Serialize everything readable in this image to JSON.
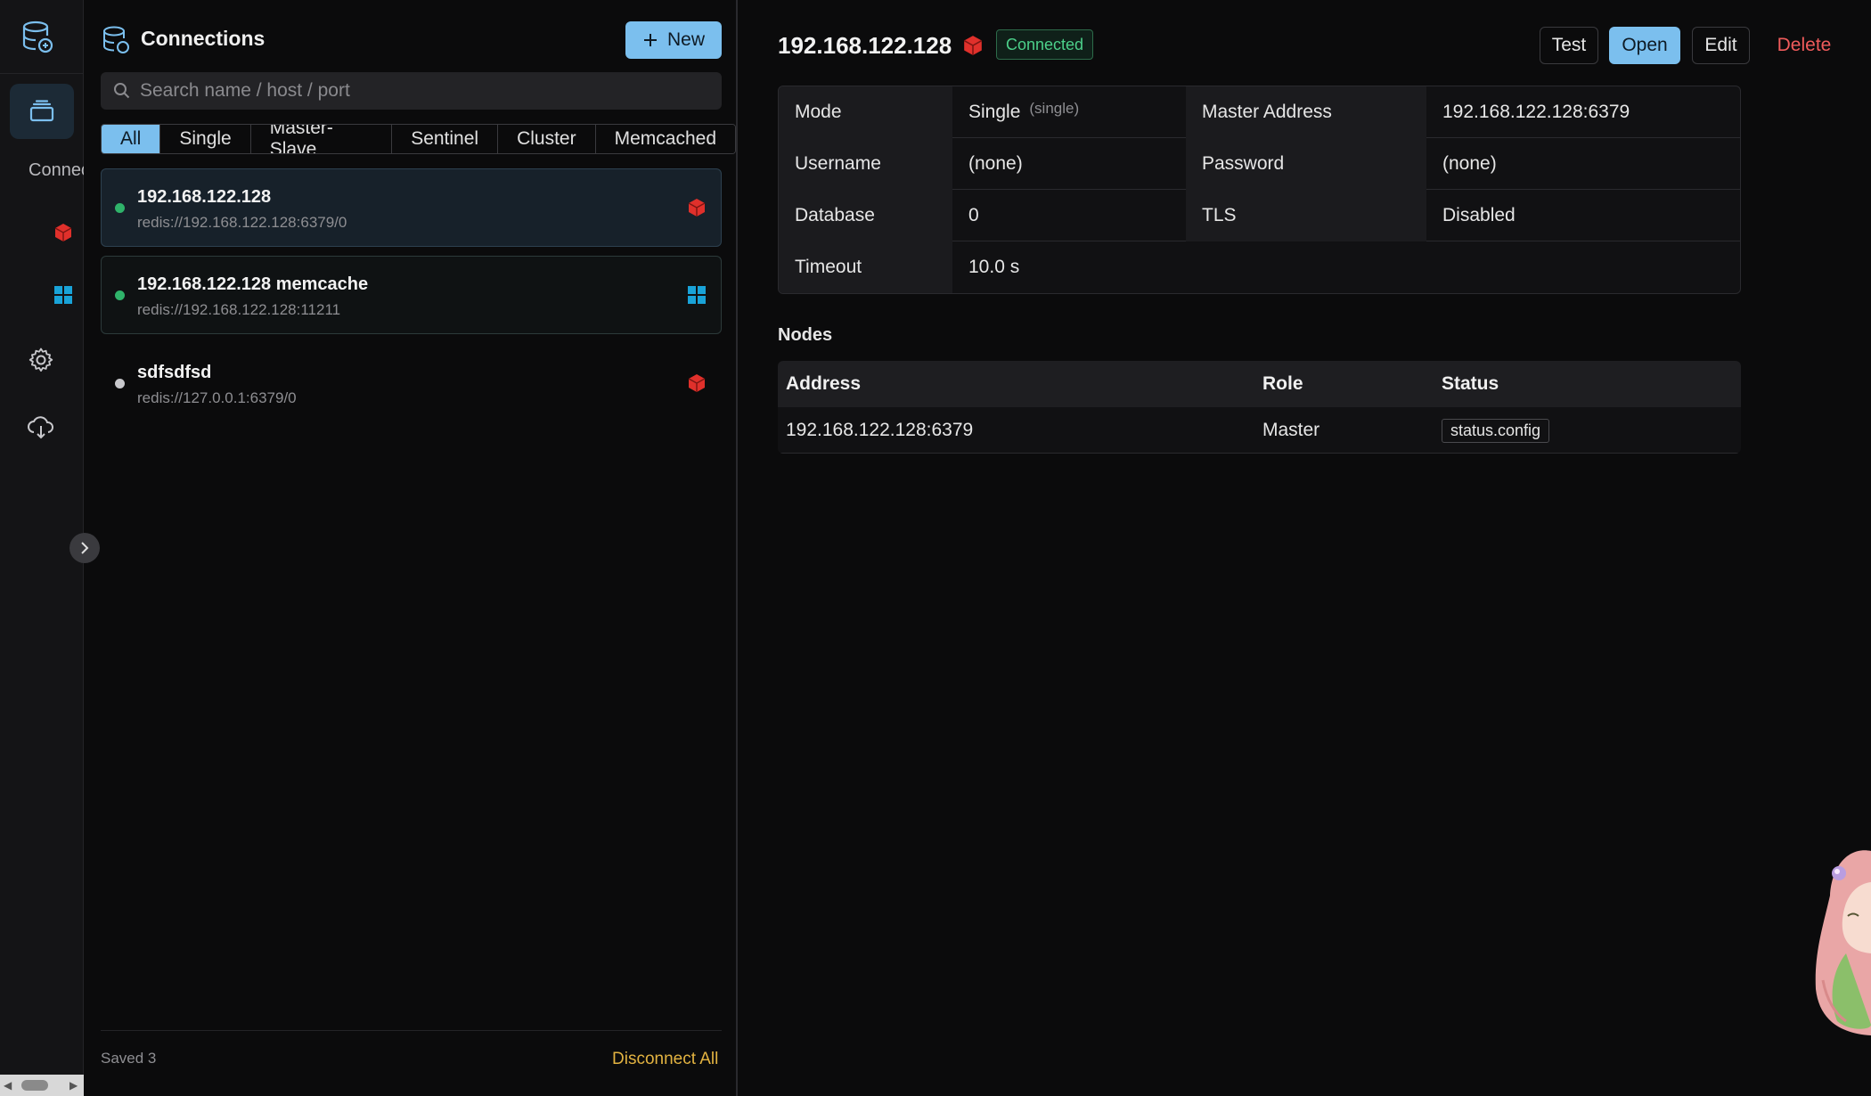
{
  "rail": {
    "section_label": "Connections",
    "items": [
      {
        "icon": "redis-cube-icon",
        "color": "#e0302b"
      },
      {
        "icon": "memcached-grid-icon",
        "color": "#19a3d8"
      }
    ]
  },
  "panel": {
    "title": "Connections",
    "new_label": "New",
    "search_placeholder": "Search name / host / port",
    "tabs": [
      "All",
      "Single",
      "Master-Slave",
      "Sentinel",
      "Cluster",
      "Memcached"
    ],
    "active_tab": "All",
    "connections": [
      {
        "name": "192.168.122.128",
        "url": "redis://192.168.122.128:6379/0",
        "status": "connected",
        "type": "redis"
      },
      {
        "name": "192.168.122.128 memcache",
        "url": "redis://192.168.122.128:11211",
        "status": "connected",
        "type": "memcached"
      },
      {
        "name": "sdfsdfsd",
        "url": "redis://127.0.0.1:6379/0",
        "status": "disconnected",
        "type": "redis"
      }
    ],
    "saved_label": "Saved 3",
    "disconnect_all_label": "Disconnect All"
  },
  "detail": {
    "title": "192.168.122.128",
    "status_badge": "Connected",
    "actions": {
      "test": "Test",
      "open": "Open",
      "edit": "Edit",
      "delete": "Delete"
    },
    "info": {
      "mode_key": "Mode",
      "mode_val": "Single",
      "mode_hint": "(single)",
      "master_key": "Master Address",
      "master_val": "192.168.122.128:6379",
      "user_key": "Username",
      "user_val": "(none)",
      "pass_key": "Password",
      "pass_val": "(none)",
      "db_key": "Database",
      "db_val": "0",
      "tls_key": "TLS",
      "tls_val": "Disabled",
      "timeout_key": "Timeout",
      "timeout_val": "10.0 s"
    },
    "nodes_title": "Nodes",
    "nodes_headers": {
      "address": "Address",
      "role": "Role",
      "status": "Status"
    },
    "nodes": [
      {
        "address": "192.168.122.128:6379",
        "role": "Master",
        "status": "status.config"
      }
    ]
  },
  "colors": {
    "accent": "#7bbfee",
    "connected": "#4cd08a",
    "danger": "#ef5b5b",
    "warn": "#e3b341",
    "redis": "#e0302b",
    "memcached": "#19a3d8"
  }
}
